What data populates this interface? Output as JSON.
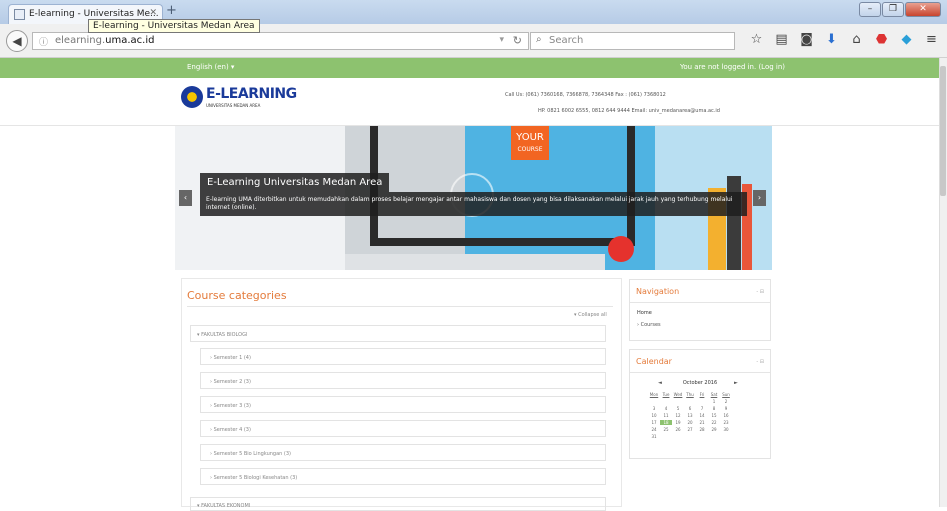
{
  "browser": {
    "tab_title": "E-learning - Universitas Me...",
    "tooltip": "E-learning - Universitas Medan Area",
    "url_prefix": "elearning.",
    "url_host": "uma.ac.id",
    "search_placeholder": "Search"
  },
  "topbar": {
    "language": "English (en) ▾",
    "login_status": "You are not logged in. (Log in)"
  },
  "header": {
    "logo_title": "E-LEARNING",
    "logo_subtitle": "UNIVERSITAS MEDAN AREA",
    "contact_line1": "Call Us: (061) 7360168, 7366878, 7364348 Fax : (061) 7368012",
    "contact_line2": "HP. 0821 6002 6555, 0812 644 9444  Email: univ_medanarea@uma.ac.id"
  },
  "slider": {
    "badge_main": "YOUR",
    "badge_sub": "COURSE",
    "caption_title": "E-Learning Universitas Medan Area",
    "caption_body": "E-learning UMA diterbitkan untuk memudahkan dalam proses belajar mengajar antar mahasiswa dan dosen yang bisa dilaksanakan melalui jarak jauh yang terhubung melalui internet (online).",
    "prev": "‹",
    "next": "›"
  },
  "courses": {
    "title": "Course categories",
    "collapse_all": "▾ Collapse all",
    "category": "▾ FAKULTAS BIOLOGI",
    "subcategories": [
      "› Semester 1 (4)",
      "› Semester 2 (3)",
      "› Semester 3 (3)",
      "› Semester 4 (3)",
      "› Semester 5 Bio Lingkungan (3)",
      "› Semester 5 Biologi Kesehatan (3)"
    ],
    "next_category": "▾ FAKULTAS EKONOMI"
  },
  "navigation": {
    "title": "Navigation",
    "controls": "- ⊟",
    "home": "Home",
    "courses": "› Courses"
  },
  "calendar": {
    "title": "Calendar",
    "controls": "- ⊟",
    "month": "October 2016",
    "prev": "◄",
    "next": "►",
    "day_names": [
      "Mon",
      "Tue",
      "Wed",
      "Thu",
      "Fri",
      "Sat",
      "Sun"
    ],
    "days": [
      "",
      "",
      "",
      "",
      "",
      "1",
      "2",
      "3",
      "4",
      "5",
      "6",
      "7",
      "8",
      "9",
      "10",
      "11",
      "12",
      "13",
      "14",
      "15",
      "16",
      "17",
      "18",
      "19",
      "20",
      "21",
      "22",
      "23",
      "24",
      "25",
      "26",
      "27",
      "28",
      "29",
      "30",
      "31"
    ],
    "today": "18"
  },
  "colors": {
    "accent_green": "#8dc26f",
    "heading_orange": "#e47b3b",
    "logo_blue": "#1a3a9a"
  }
}
